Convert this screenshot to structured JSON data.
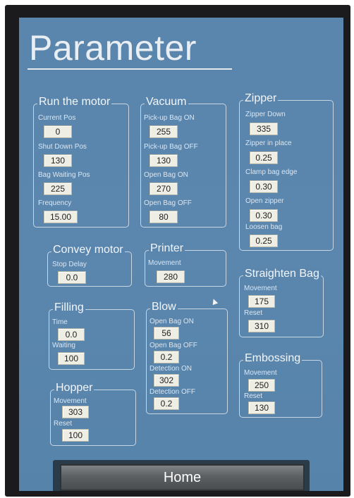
{
  "title": "Parameter",
  "home_label": "Home",
  "run_motor": {
    "title": "Run the motor",
    "current_pos_label": "Current Pos",
    "current_pos_value": "0",
    "shutdown_label": "Shut Down Pos",
    "shutdown_value": "130",
    "bag_waiting_label": "Bag Waiting Pos",
    "bag_waiting_value": "225",
    "frequency_label": "Frequency",
    "frequency_value": "15.00"
  },
  "vacuum": {
    "title": "Vacuum",
    "pickup_on_label": "Pick-up Bag ON",
    "pickup_on_value": "255",
    "pickup_off_label": "Pick-up Bag OFF",
    "pickup_off_value": "130",
    "open_on_label": "Open Bag ON",
    "open_on_value": "270",
    "open_off_label": "Open Bag OFF",
    "open_off_value": "80"
  },
  "zipper": {
    "title": "Zipper",
    "down_label": "Zipper Down",
    "down_value": "335",
    "in_place_label": "Zipper in place",
    "in_place_value": "0.25",
    "clamp_label": "Clamp bag edge",
    "clamp_value": "0.30",
    "open_label": "Open zipper",
    "open_value": "0.30",
    "loosen_label": "Loosen bag",
    "loosen_value": "0.25"
  },
  "convey": {
    "title": "Convey motor",
    "stop_delay_label": "Stop Delay",
    "stop_delay_value": "0.0"
  },
  "printer": {
    "title": "Printer",
    "movement_label": "Movement",
    "movement_value": "280"
  },
  "straighten": {
    "title": "Straighten Bag",
    "movement_label": "Movement",
    "movement_value": "175",
    "reset_label": "Reset",
    "reset_value": "310"
  },
  "filling": {
    "title": "Filling",
    "time_label": "Time",
    "time_value": "0.0",
    "waiting_label": "Waiting",
    "waiting_value": "100"
  },
  "blow": {
    "title": "Blow",
    "open_on_label": "Open Bag ON",
    "open_on_value": "56",
    "open_off_label": "Open Bag OFF",
    "open_off_value": "0.2",
    "det_on_label": "Detection ON",
    "det_on_value": "302",
    "det_off_label": "Detection OFF",
    "det_off_value": "0.2"
  },
  "embossing": {
    "title": "Embossing",
    "movement_label": "Movement",
    "movement_value": "250",
    "reset_label": "Reset",
    "reset_value": "130"
  },
  "hopper": {
    "title": "Hopper",
    "movement_label": "Movement",
    "movement_value": "303",
    "reset_label": "Reset",
    "reset_value": "100"
  }
}
